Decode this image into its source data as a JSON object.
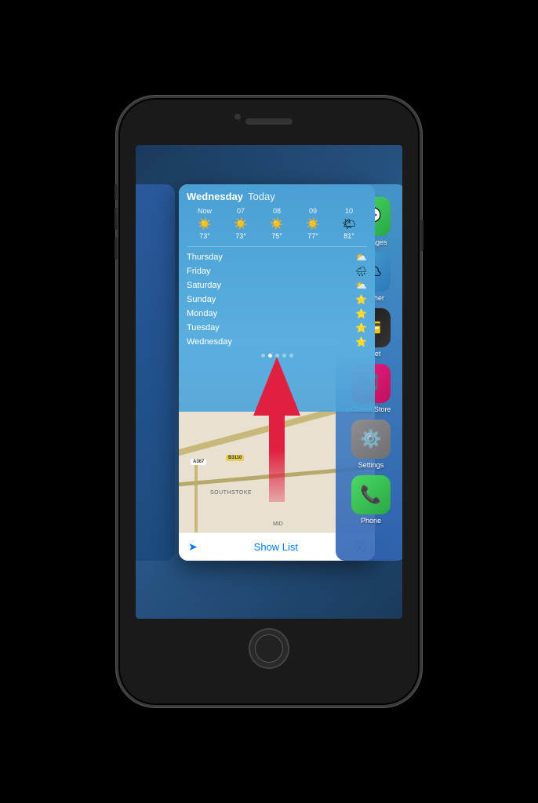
{
  "weather": {
    "day": "Wednesday",
    "today": "Today",
    "hourly": [
      {
        "label": "Now",
        "icon": "☀️",
        "temp": "73°"
      },
      {
        "label": "07",
        "icon": "☀️",
        "temp": "73°"
      },
      {
        "label": "08",
        "icon": "☀️",
        "temp": "75°"
      },
      {
        "label": "09",
        "icon": "☀️",
        "temp": "77°"
      },
      {
        "label": "10",
        "icon": "🌤",
        "temp": "81°"
      }
    ],
    "forecast": [
      {
        "day": "Thursday",
        "icon": "⛅"
      },
      {
        "day": "Friday",
        "icon": "🌧"
      },
      {
        "day": "Saturday",
        "icon": "⛅"
      },
      {
        "day": "Sunday",
        "icon": "⭐"
      },
      {
        "day": "Monday",
        "icon": "⭐"
      },
      {
        "day": "Tuesday",
        "icon": "⭐"
      },
      {
        "day": "Wednesday",
        "icon": "⭐"
      }
    ]
  },
  "map": {
    "show_list": "Show List",
    "road_labels": [
      "A367",
      "B3110"
    ],
    "place_labels": [
      "SOUTHSTOKE",
      "MID"
    ]
  },
  "apps": [
    {
      "name": "Messages",
      "icon_class": "app-icon-messages",
      "icon": "💬"
    },
    {
      "name": "Weather",
      "icon_class": "app-icon-weather",
      "icon": "🌤"
    },
    {
      "name": "Wallet",
      "icon_class": "app-icon-wallet",
      "icon": "💳"
    },
    {
      "name": "iTunes Store",
      "icon_class": "app-icon-itunes",
      "icon": "🎵"
    },
    {
      "name": "Settings",
      "icon_class": "app-icon-settings",
      "icon": "⚙️"
    },
    {
      "name": "Phone",
      "icon_class": "app-icon-phone",
      "icon": "📞"
    }
  ]
}
